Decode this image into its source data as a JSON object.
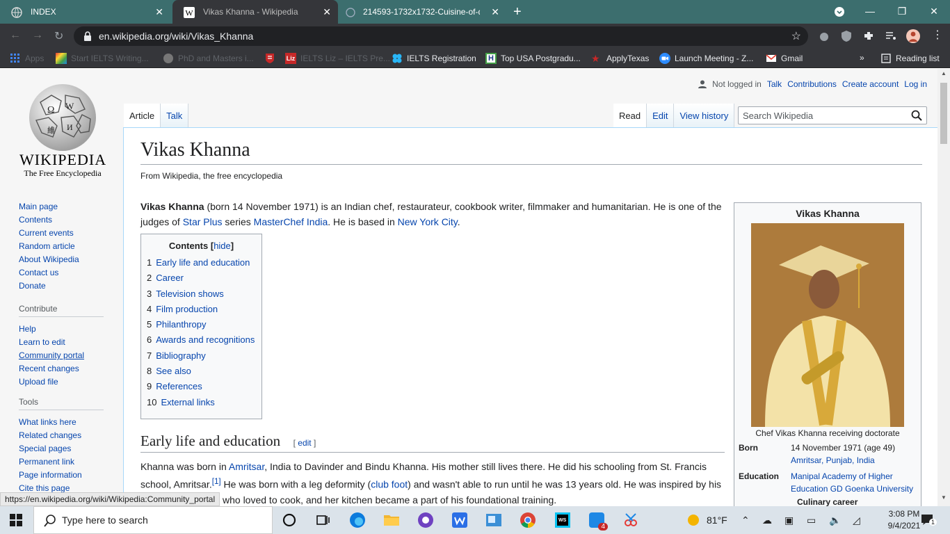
{
  "browser": {
    "tabs": [
      {
        "title": "INDEX"
      },
      {
        "title": "Vikas Khanna - Wikipedia"
      },
      {
        "title": "214593-1732x1732-Cuisine-of-di"
      }
    ],
    "url": "en.wikipedia.org/wiki/Vikas_Khanna",
    "bookmarks": [
      {
        "label": "Apps"
      },
      {
        "label": "Start IELTS Writing..."
      },
      {
        "label": "PhD and Masters i..."
      },
      {
        "label": ""
      },
      {
        "label": "IELTS Liz – IELTS Pre..."
      },
      {
        "label": "IELTS Registration"
      },
      {
        "label": "Top USA Postgradu..."
      },
      {
        "label": "ApplyTexas"
      },
      {
        "label": "Launch Meeting - Z..."
      },
      {
        "label": "Gmail"
      }
    ],
    "bookmarks_more": "»",
    "reading_list": "Reading list"
  },
  "wiki": {
    "wordmark": "Wikipedia",
    "tagline": "The Free Encyclopedia",
    "personal": {
      "not_logged_in": "Not logged in",
      "talk": "Talk",
      "contributions": "Contributions",
      "create_account": "Create account",
      "log_in": "Log in"
    },
    "tabs_left": [
      "Article",
      "Talk"
    ],
    "tabs_right": [
      "Read",
      "Edit",
      "View history"
    ],
    "search_placeholder": "Search Wikipedia",
    "nav": [
      "Main page",
      "Contents",
      "Current events",
      "Random article",
      "About Wikipedia",
      "Contact us",
      "Donate"
    ],
    "contribute_title": "Contribute",
    "contribute": [
      "Help",
      "Learn to edit",
      "Community portal",
      "Recent changes",
      "Upload file"
    ],
    "tools_title": "Tools",
    "tools": [
      "What links here",
      "Related changes",
      "Special pages",
      "Permanent link",
      "Page information",
      "Cite this page"
    ]
  },
  "article": {
    "title": "Vikas Khanna",
    "site_sub": "From Wikipedia, the free encyclopedia",
    "lead": {
      "bold": "Vikas Khanna",
      "t1": " (born 14 November 1971) is an Indian chef, restaurateur, cookbook writer, filmmaker and humanitarian. He is one of the judges of ",
      "l1": "Star Plus",
      "t2": " series ",
      "l2": "MasterChef India",
      "t3": ". He is based in ",
      "l3": "New York City",
      "t4": "."
    },
    "toc": {
      "title": "Contents",
      "hide": "hide",
      "items": [
        {
          "num": "1",
          "label": "Early life and education"
        },
        {
          "num": "2",
          "label": "Career"
        },
        {
          "num": "3",
          "label": "Television shows"
        },
        {
          "num": "4",
          "label": "Film production"
        },
        {
          "num": "5",
          "label": "Philanthropy"
        },
        {
          "num": "6",
          "label": "Awards and recognitions"
        },
        {
          "num": "7",
          "label": "Bibliography"
        },
        {
          "num": "8",
          "label": "See also"
        },
        {
          "num": "9",
          "label": "References"
        },
        {
          "num": "10",
          "label": "External links"
        }
      ]
    },
    "section": {
      "heading": "Early life and education",
      "edit": "edit",
      "p1": "Khanna was born in ",
      "l1": "Amritsar",
      "p2": ", India to Davinder and Bindu Khanna. His mother still lives there. He did his schooling from St. Francis school, Amritsar.",
      "ref": "[1]",
      "p3": " He was born with a leg deformity (",
      "l2": "club foot",
      "p4": ") and wasn't able to run until he was 13 years old. He was inspired by his",
      "p5": "who loved to cook, and her kitchen became a part of his foundational training."
    },
    "infobox": {
      "title": "Vikas Khanna",
      "caption": "Chef Vikas Khanna receiving doctorate",
      "born_label": "Born",
      "born_value": "14 November 1971 (age 49)",
      "born_place": "Amritsar, Punjab, India",
      "education_label": "Education",
      "education_value": "Manipal Academy of Higher Education GD Goenka University",
      "next_label": "Culinary career"
    }
  },
  "status_url": "https://en.wikipedia.org/wiki/Wikipedia:Community_portal",
  "taskbar": {
    "search_placeholder": "Type here to search",
    "temperature": "81°F",
    "time": "3:08 PM",
    "date": "9/4/2021",
    "notification_count": "4",
    "action_center_count": "1"
  }
}
